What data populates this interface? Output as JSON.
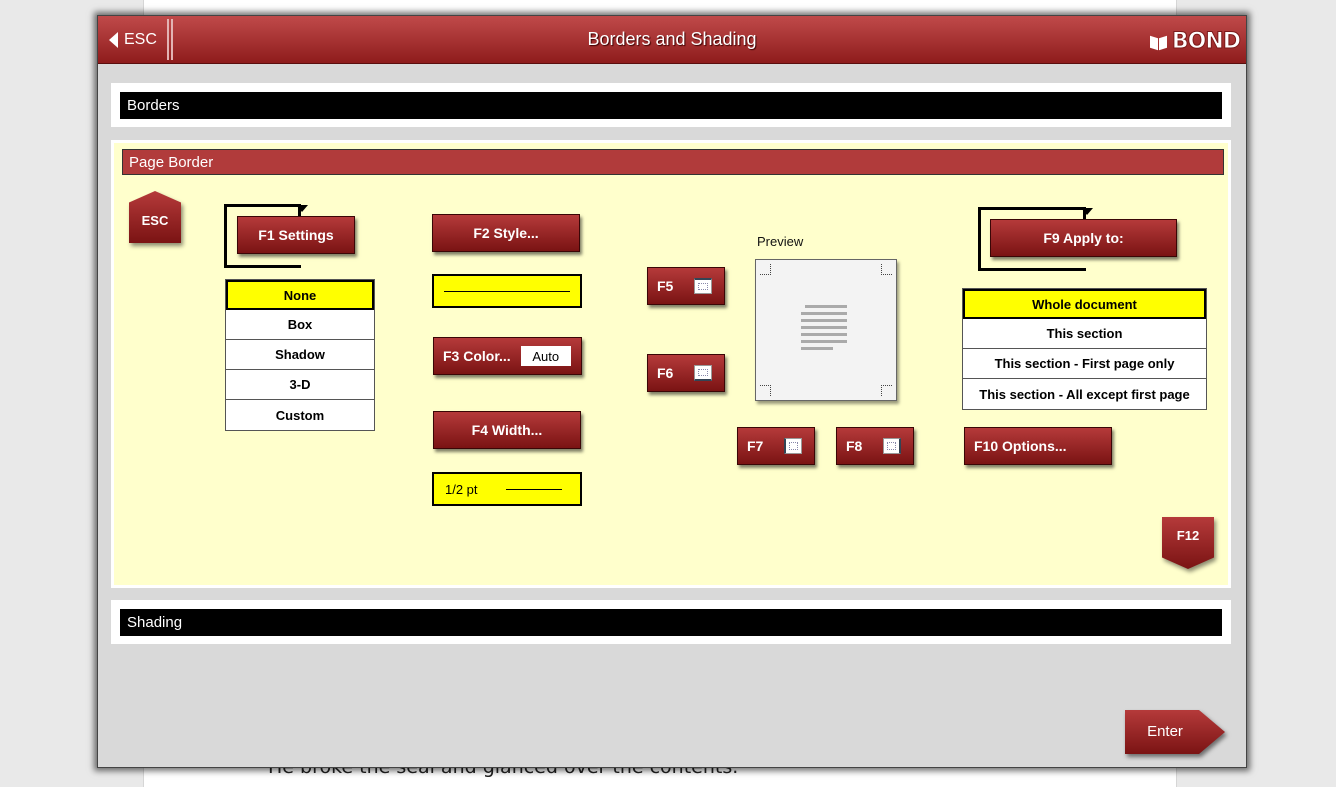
{
  "document": {
    "visible_text": "He broke the seal and glanced over the contents."
  },
  "titlebar": {
    "esc_label": "ESC",
    "title": "Borders and Shading",
    "logo_text": "BOND"
  },
  "borders_section": {
    "label": "Borders"
  },
  "page_border": {
    "header": "Page Border",
    "esc_label": "ESC",
    "f1_settings": "F1 Settings",
    "settings_options": [
      "None",
      "Box",
      "Shadow",
      "3-D",
      "Custom"
    ],
    "settings_selected": "None",
    "f2_style": "F2 Style...",
    "f3_color": "F3 Color...",
    "color_value": "Auto",
    "f4_width": "F4 Width...",
    "width_value": "1/2 pt",
    "f5": "F5",
    "f6": "F6",
    "f7": "F7",
    "f8": "F8",
    "preview_label": "Preview",
    "f9_apply_to": "F9 Apply to:",
    "apply_options": [
      "Whole document",
      "This section",
      "This section - First page only",
      "This section - All except first page"
    ],
    "apply_selected": "Whole document",
    "f10_options": "F10 Options...",
    "f12_label": "F12"
  },
  "shading_section": {
    "label": "Shading"
  },
  "footer": {
    "enter_label": "Enter"
  },
  "colors": {
    "accent": "#9e2a2a",
    "panel_bg": "#ffffcc",
    "highlight": "#ffff00"
  }
}
